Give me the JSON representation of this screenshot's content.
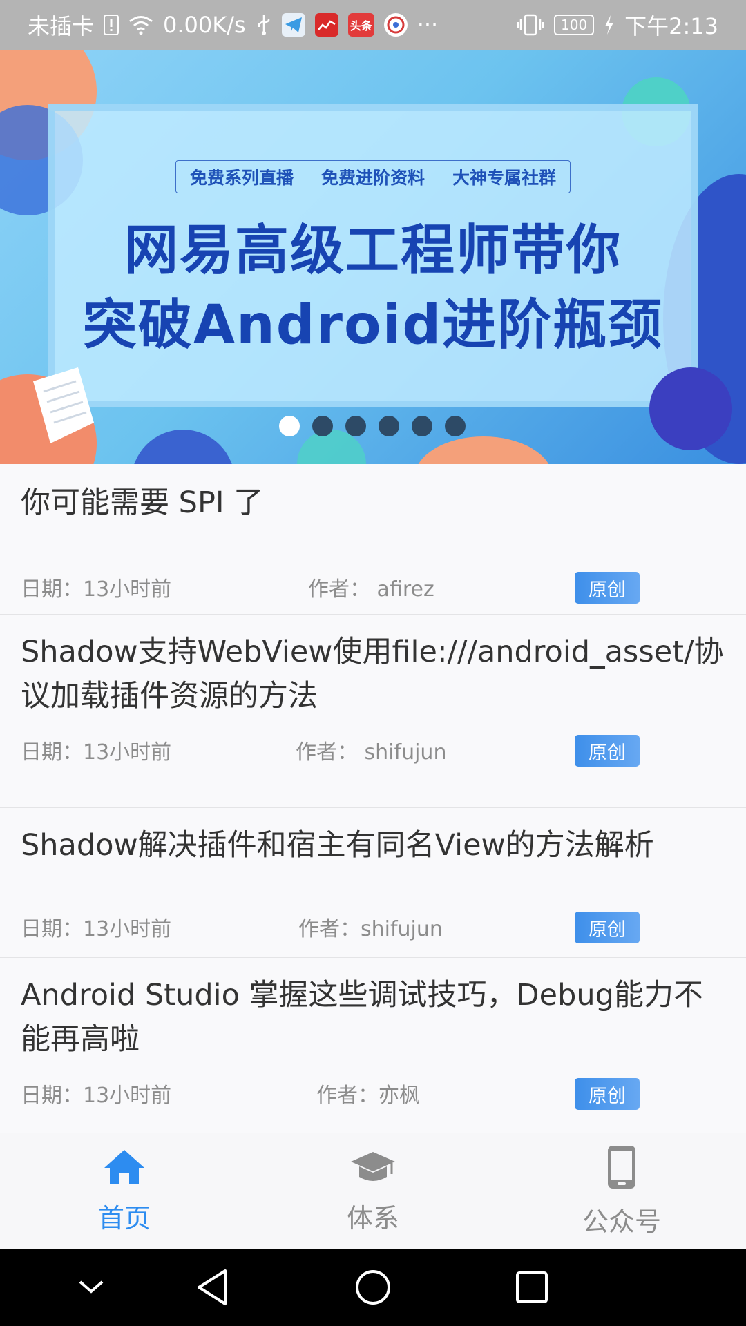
{
  "status_bar": {
    "carrier": "未插卡",
    "net_speed": "0.00K/s",
    "battery": "100",
    "time": "下午2:13",
    "more": "···",
    "app_badge": "头条"
  },
  "banner": {
    "tagline": [
      "免费系列直播",
      "免费进阶资料",
      "大神专属社群"
    ],
    "title_line1": "网易高级工程师带你",
    "title_line2": "突破Android进阶瓶颈",
    "page_count": 6,
    "active_index": 0
  },
  "articles": [
    {
      "title": "你可能需要 SPI 了",
      "date_label": "日期：",
      "date": "13小时前",
      "author_label": "作者：",
      "author": "afirez",
      "tag": "原创"
    },
    {
      "title": "Shadow支持WebView使用file:///android_asset/协议加载插件资源的方法",
      "date_label": "日期：",
      "date": "13小时前",
      "author_label": "作者：",
      "author": "shifujun",
      "tag": "原创"
    },
    {
      "title": "Shadow解决插件和宿主有同名View的方法解析",
      "date_label": "日期：",
      "date": "13小时前",
      "author_label": "作者：",
      "author": "shifujun",
      "tag": "原创"
    },
    {
      "title": "Android Studio 掌握这些调试技巧，Debug能力不能再高啦",
      "date_label": "日期：",
      "date": "13小时前",
      "author_label": "作者：",
      "author": "亦枫",
      "tag": "原创"
    }
  ],
  "tabs": [
    {
      "label": "首页",
      "icon": "home-icon",
      "active": true
    },
    {
      "label": "体系",
      "icon": "graduation-cap-icon",
      "active": false
    },
    {
      "label": "公众号",
      "icon": "phone-icon",
      "active": false
    }
  ],
  "colors": {
    "accent": "#2d8cf0",
    "tag": "#4a95ec",
    "inactive": "#8c8c8c"
  }
}
